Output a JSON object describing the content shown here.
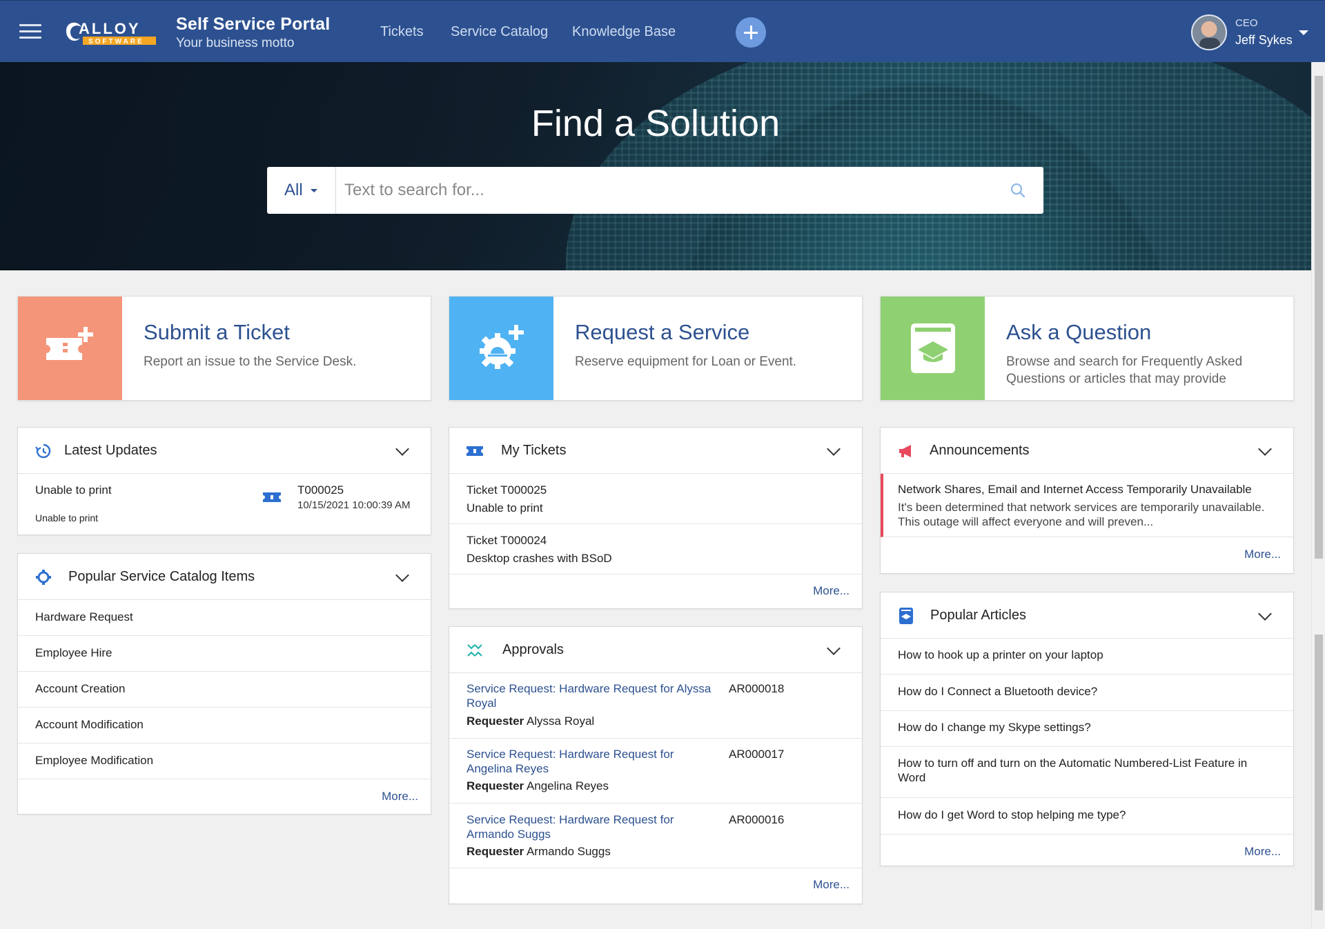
{
  "header": {
    "portal_title": "Self Service Portal",
    "motto": "Your business motto",
    "logo_word": "ALLOY",
    "logo_sub": "SOFTWARE",
    "nav": [
      "Tickets",
      "Service Catalog",
      "Knowledge Base"
    ],
    "user_role": "CEO",
    "user_name": "Jeff Sykes"
  },
  "hero": {
    "title": "Find a Solution",
    "scope": "All",
    "placeholder": "Text to search for..."
  },
  "actions": [
    {
      "title": "Submit a Ticket",
      "desc": "Report an issue to the Service Desk.",
      "color": "#f4957a",
      "icon": "ticket-plus-icon"
    },
    {
      "title": "Request a Service",
      "desc": "Reserve equipment for Loan or Event.",
      "color": "#4fb2f2",
      "icon": "gear-plus-icon"
    },
    {
      "title": "Ask a Question",
      "desc": "Browse and search for Frequently Asked Questions or articles that may provide",
      "color": "#8fd172",
      "icon": "book-cap-icon"
    }
  ],
  "latest_updates": {
    "title": "Latest Updates",
    "item": {
      "subject": "Unable to print",
      "detail": "Unable to print",
      "id": "T000025",
      "date": "10/15/2021 10:00:39 AM"
    }
  },
  "popular_catalog": {
    "title": "Popular Service Catalog Items",
    "items": [
      "Hardware Request",
      "Employee Hire",
      "Account Creation",
      "Account Modification",
      "Employee Modification"
    ],
    "more": "More..."
  },
  "my_tickets": {
    "title": "My Tickets",
    "items": [
      {
        "id": "Ticket T000025",
        "desc": "Unable to print"
      },
      {
        "id": "Ticket T000024",
        "desc": "Desktop crashes with BSoD"
      }
    ],
    "more": "More..."
  },
  "approvals": {
    "title": "Approvals",
    "requester_label": "Requester",
    "items": [
      {
        "line1": "Service Request: Hardware Request for Alyssa",
        "line2": "Royal",
        "id": "AR000018",
        "requester": "Alyssa Royal"
      },
      {
        "line1": "Service Request: Hardware Request for",
        "line2": "Angelina Reyes",
        "id": "AR000017",
        "requester": "Angelina Reyes"
      },
      {
        "line1": "Service Request: Hardware Request for",
        "line2": "Armando Suggs",
        "id": "AR000016",
        "requester": "Armando Suggs"
      }
    ],
    "more": "More..."
  },
  "announcements": {
    "title": "Announcements",
    "item": {
      "headline": "Network Shares, Email and Internet Access Temporarily Unavailable",
      "body1": "It's been determined that network services are temporarily unavailable.",
      "body2": "This outage will affect everyone and will preven..."
    },
    "more": "More..."
  },
  "popular_articles": {
    "title": "Popular Articles",
    "items": [
      {
        "l1": "How to hook up a printer on your laptop",
        "l2": ""
      },
      {
        "l1": "How do I Connect a Bluetooth device?",
        "l2": ""
      },
      {
        "l1": "How do I change my Skype settings?",
        "l2": ""
      },
      {
        "l1": "How to turn off and turn on the Automatic Numbered-List Feature in",
        "l2": "Word"
      },
      {
        "l1": "How do I get Word to stop helping me type?",
        "l2": ""
      }
    ],
    "more": "More..."
  }
}
